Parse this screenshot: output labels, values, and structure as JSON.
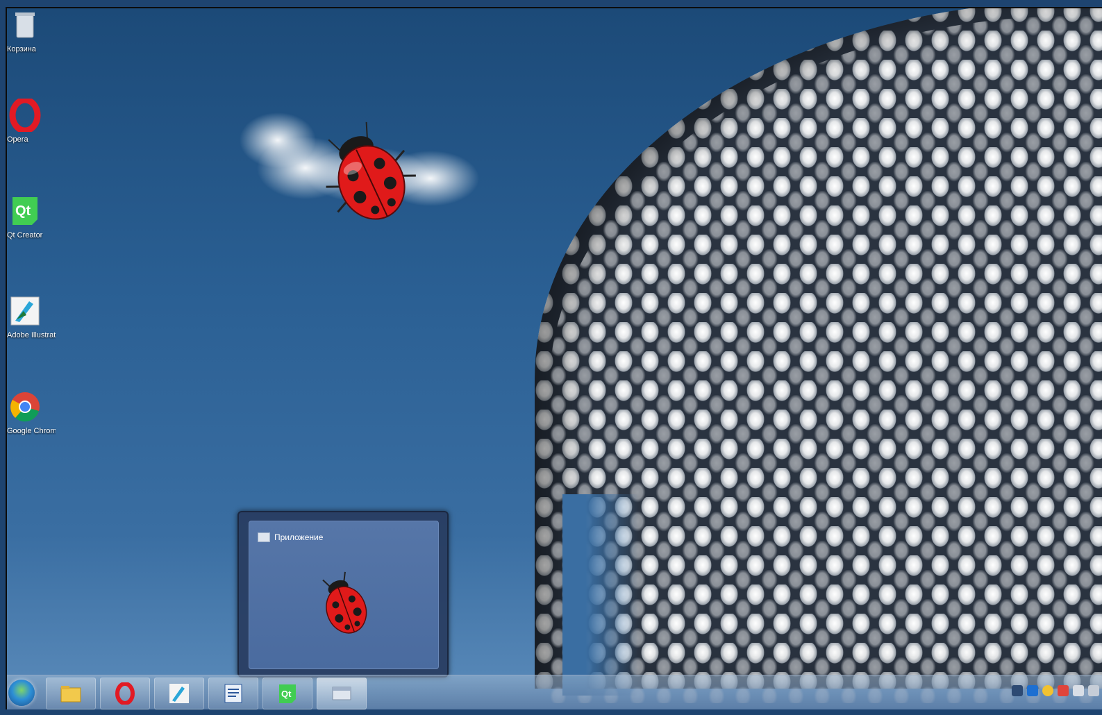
{
  "desktop": {
    "icons": [
      {
        "name": "recycle-bin-icon",
        "label": "Корзина"
      },
      {
        "name": "opera-icon",
        "label": "Opera"
      },
      {
        "name": "qt-creator-icon",
        "label": "Qt Creator"
      },
      {
        "name": "adobe-illustrator-icon",
        "label": "Adobe Illustrator"
      },
      {
        "name": "google-chrome-icon",
        "label": "Google Chrome"
      }
    ]
  },
  "thumbnail": {
    "title": "Приложение"
  },
  "taskbar": {
    "buttons": [
      "explorer-icon",
      "opera-icon",
      "illustrator-icon",
      "word-icon",
      "qt-creator-icon",
      "app-icon"
    ],
    "tray_icons": [
      "network-icon",
      "bluetooth-icon",
      "emoji-icon",
      "flag-icon",
      "battery-icon",
      "signal-icon"
    ]
  },
  "colors": {
    "sky_top": "#1c4a78",
    "sky_bottom": "#5c8cbb",
    "ladybug_red": "#e01a1a"
  }
}
